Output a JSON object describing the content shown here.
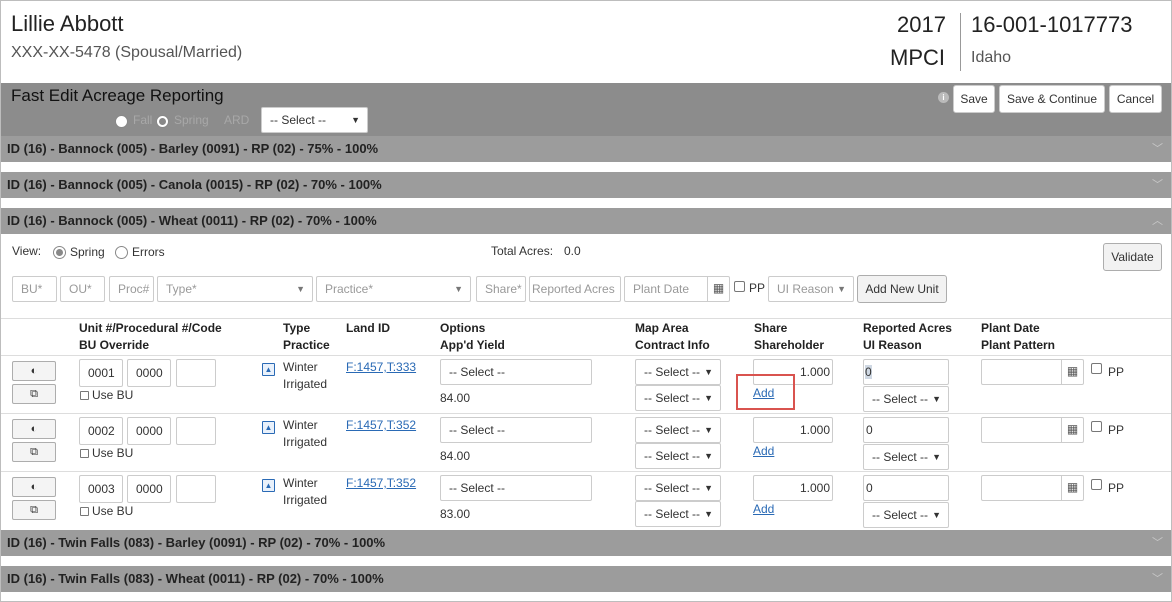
{
  "header": {
    "name": "Lillie Abbott",
    "ssn_line": "XXX-XX-5478 (Spousal/Married)",
    "year": "2017",
    "program": "MPCI",
    "policy_number": "16-001-1017773",
    "state": "Idaho"
  },
  "toolbar": {
    "title": "Fast Edit Acreage Reporting",
    "fall_label": "Fall",
    "spring_label": "Spring",
    "ard_label": "ARD",
    "ard_select": "-- Select --",
    "info_icon": "info-icon",
    "save_label": "Save",
    "save_continue_label": "Save & Continue",
    "cancel_label": "Cancel"
  },
  "sections": {
    "s1": "ID (16) - Bannock (005) - Barley (0091) - RP (02) - 75% - 100%",
    "s2": "ID (16) - Bannock (005) - Canola (0015) - RP (02) - 70% - 100%",
    "s3": "ID (16) - Bannock (005) - Wheat (0011) - RP (02) - 70% - 100%",
    "s4": "ID (16) - Twin Falls (083) - Barley (0091) - RP (02) - 70% - 100%",
    "s5": "ID (16) - Twin Falls (083) - Wheat (0011) - RP (02) - 70% - 100%"
  },
  "panel": {
    "view_label": "View:",
    "view_spring": "Spring",
    "view_errors": "Errors",
    "total_acres_label": "Total Acres:",
    "total_acres_value": "0.0",
    "validate_label": "Validate",
    "add_bu_placeholder": "BU*",
    "add_ou_placeholder": "OU*",
    "add_proc_placeholder": "Proc#",
    "add_type_placeholder": "Type*",
    "add_practice_placeholder": "Practice*",
    "add_share_placeholder": "Share*",
    "add_reported_placeholder": "Reported Acres",
    "add_plant_date_placeholder": "Plant Date",
    "add_pp_label": "PP",
    "add_ui_reason_placeholder": "UI Reason",
    "add_new_unit_label": "Add New Unit"
  },
  "columns": {
    "unit": "Unit #/Procedural #/Code",
    "bu_override": "BU Override",
    "type": "Type",
    "practice": "Practice",
    "land_id": "Land ID",
    "options": "Options",
    "appd_yield": "App'd Yield",
    "map_area": "Map Area",
    "contract_info": "Contract Info",
    "share": "Share",
    "shareholder": "Shareholder",
    "reported_acres": "Reported Acres",
    "ui_reason": "UI Reason",
    "plant_date": "Plant Date",
    "plant_pattern": "Plant Pattern"
  },
  "rows": [
    {
      "unit": "0001",
      "proc": "0000",
      "code": "",
      "use_bu": "Use BU",
      "type": "Winter",
      "practice": "Irrigated",
      "land_id": "F:1457,T:333",
      "options": "-- Select --",
      "yield": "84.00",
      "map_area": "-- Select --",
      "contract": "-- Select --",
      "share": "1.000",
      "add": "Add",
      "reported": "0",
      "ui_reason": "-- Select --",
      "plant_date": "",
      "pp": "PP"
    },
    {
      "unit": "0002",
      "proc": "0000",
      "code": "",
      "use_bu": "Use BU",
      "type": "Winter",
      "practice": "Irrigated",
      "land_id": "F:1457,T:352",
      "options": "-- Select --",
      "yield": "84.00",
      "map_area": "-- Select --",
      "contract": "-- Select --",
      "share": "1.000",
      "add": "Add",
      "reported": "0",
      "ui_reason": "-- Select --",
      "plant_date": "",
      "pp": "PP"
    },
    {
      "unit": "0003",
      "proc": "0000",
      "code": "",
      "use_bu": "Use BU",
      "type": "Winter",
      "practice": "Irrigated",
      "land_id": "F:1457,T:352",
      "options": "-- Select --",
      "yield": "83.00",
      "map_area": "-- Select --",
      "contract": "-- Select --",
      "share": "1.000",
      "add": "Add",
      "reported": "0",
      "ui_reason": "-- Select --",
      "plant_date": "",
      "pp": "PP"
    }
  ],
  "highlight_color": "#d9534f"
}
